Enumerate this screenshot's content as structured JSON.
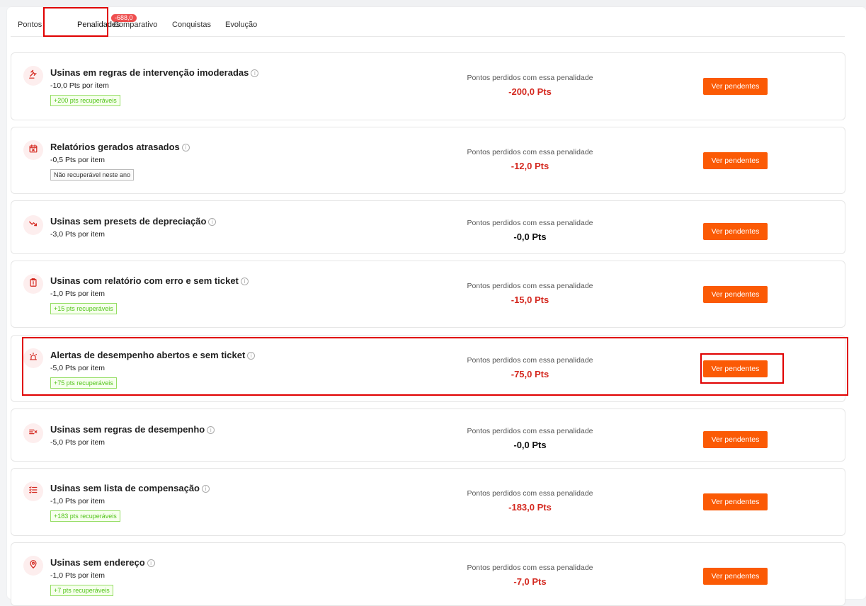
{
  "tabs": [
    {
      "label": "Pontos"
    },
    {
      "label": "Penalidades",
      "badge": "-688,0"
    },
    {
      "label": "Comparativo"
    },
    {
      "label": "Conquistas"
    },
    {
      "label": "Evolução"
    }
  ],
  "penalties": [
    {
      "title": "Usinas em regras de intervenção imoderadas",
      "rate": "-10,0 Pts por item",
      "tag": "+200 pts recuperáveis",
      "tag_type": "green",
      "lost_label": "Pontos perdidos com essa penalidade",
      "lost_value": "-200,0 Pts",
      "button": "Ver pendentes",
      "icon": "gavel-icon"
    },
    {
      "title": "Relatórios gerados atrasados",
      "rate": "-0,5 Pts por item",
      "tag": "Não recuperável neste ano",
      "tag_type": "gray",
      "lost_label": "Pontos perdidos com essa penalidade",
      "lost_value": "-12,0 Pts",
      "button": "Ver pendentes",
      "icon": "calendar-x-icon"
    },
    {
      "title": "Usinas sem presets de depreciação",
      "rate": "-3,0 Pts por item",
      "tag": "",
      "tag_type": "",
      "lost_label": "Pontos perdidos com essa penalidade",
      "lost_value": "-0,0 Pts",
      "button": "Ver pendentes",
      "icon": "trend-down-icon"
    },
    {
      "title": "Usinas com relatório com erro e sem ticket",
      "rate": "-1,0 Pts por item",
      "tag": "+15 pts recuperáveis",
      "tag_type": "green",
      "lost_label": "Pontos perdidos com essa penalidade",
      "lost_value": "-15,0 Pts",
      "button": "Ver pendentes",
      "icon": "clipboard-alert-icon"
    },
    {
      "title": "Alertas de desempenho abertos e sem ticket",
      "rate": "-5,0 Pts por item",
      "tag": "+75 pts recuperáveis",
      "tag_type": "green",
      "lost_label": "Pontos perdidos com essa penalidade",
      "lost_value": "-75,0 Pts",
      "button": "Ver pendentes",
      "icon": "siren-icon"
    },
    {
      "title": "Usinas sem regras de desempenho",
      "rate": "-5,0 Pts por item",
      "tag": "",
      "tag_type": "",
      "lost_label": "Pontos perdidos com essa penalidade",
      "lost_value": "-0,0 Pts",
      "button": "Ver pendentes",
      "icon": "list-x-icon"
    },
    {
      "title": "Usinas sem lista de compensação",
      "rate": "-1,0 Pts por item",
      "tag": "+183 pts recuperáveis",
      "tag_type": "green",
      "lost_label": "Pontos perdidos com essa penalidade",
      "lost_value": "-183,0 Pts",
      "button": "Ver pendentes",
      "icon": "list-check-icon"
    },
    {
      "title": "Usinas sem endereço",
      "rate": "-1,0 Pts por item",
      "tag": "+7 pts recuperáveis",
      "tag_type": "green",
      "lost_label": "Pontos perdidos com essa penalidade",
      "lost_value": "-7,0 Pts",
      "button": "Ver pendentes",
      "icon": "map-pin-icon"
    }
  ],
  "colors": {
    "accent": "#fb5a05",
    "loss_red": "#d4281f",
    "highlight": "#e00000"
  }
}
